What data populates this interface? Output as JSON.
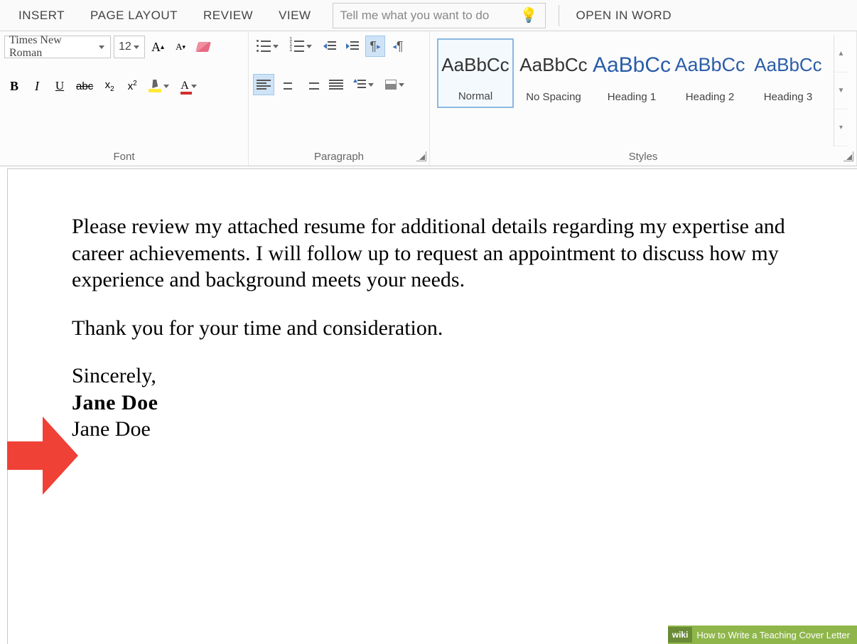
{
  "tabs": {
    "insert": "INSERT",
    "page_layout": "PAGE LAYOUT",
    "review": "REVIEW",
    "view": "VIEW",
    "tell_me_placeholder": "Tell me what you want to do",
    "open_in_word": "OPEN IN WORD"
  },
  "font": {
    "name": "Times New Roman",
    "size": "12",
    "group_label": "Font"
  },
  "paragraph": {
    "group_label": "Paragraph"
  },
  "styles": {
    "group_label": "Styles",
    "sample": "AaBbCc",
    "items": [
      {
        "label": "Normal",
        "blue": false
      },
      {
        "label": "No Spacing",
        "blue": false
      },
      {
        "label": "Heading 1",
        "blue": true
      },
      {
        "label": "Heading 2",
        "blue": true
      },
      {
        "label": "Heading 3",
        "blue": true
      }
    ]
  },
  "document": {
    "para1": "Please review my attached resume for additional details regarding my expertise and career achievements. I will follow up to request an appointment to discuss how my experience and background meets your needs.",
    "para2": "Thank you for your time and consideration.",
    "closing": "Sincerely,",
    "signature_script": "Jane Doe",
    "signature_print": "Jane Doe"
  },
  "footer": {
    "brand": "wikiHow",
    "prefix": "wiki",
    "title": "How to Write a Teaching Cover Letter"
  },
  "icons": {
    "bold": "B",
    "italic": "I",
    "underline": "U",
    "strike": "abc",
    "sub": "x",
    "sup": "x",
    "fontcolor": "A",
    "grow": "A",
    "shrink": "A",
    "pilcrow_ltr": "¶",
    "pilcrow_rtl": "¶",
    "up": "▲",
    "down": "▼",
    "more": "▾"
  }
}
